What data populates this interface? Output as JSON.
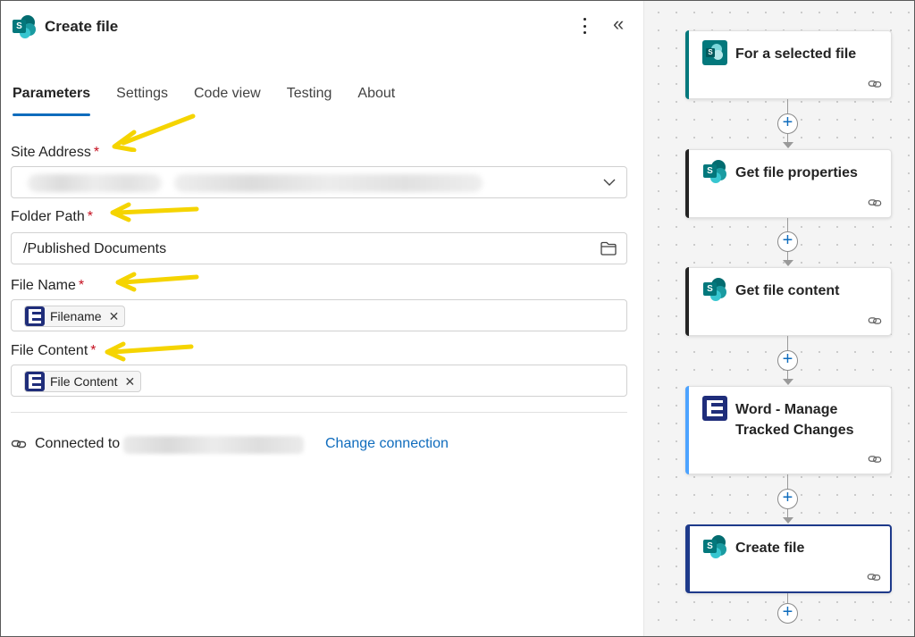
{
  "panel": {
    "title": "Create file",
    "more_icon": "more-vertical-icon",
    "collapse_icon": "chevron-double-left-icon"
  },
  "tabs": [
    {
      "label": "Parameters",
      "active": true
    },
    {
      "label": "Settings",
      "active": false
    },
    {
      "label": "Code view",
      "active": false
    },
    {
      "label": "Testing",
      "active": false
    },
    {
      "label": "About",
      "active": false
    }
  ],
  "fields": {
    "site_address": {
      "label": "Site Address",
      "required": "*",
      "value": ""
    },
    "folder_path": {
      "label": "Folder Path",
      "required": "*",
      "value": "/Published Documents"
    },
    "file_name": {
      "label": "File Name",
      "required": "*",
      "token": "Filename",
      "remove": "✕"
    },
    "file_content": {
      "label": "File Content",
      "required": "*",
      "token": "File Content",
      "remove": "✕"
    }
  },
  "connection": {
    "label": "Connected to",
    "change_link": "Change connection"
  },
  "flow": {
    "steps": [
      {
        "title": "For a selected file",
        "icon": "sharepoint-icon",
        "accent": "#03787c"
      },
      {
        "title": "Get file properties",
        "icon": "sharepoint-icon",
        "accent": "#242424"
      },
      {
        "title": "Get file content",
        "icon": "sharepoint-icon",
        "accent": "#242424"
      },
      {
        "title": "Word - Manage Tracked Changes",
        "icon": "encodian-icon",
        "accent": "#4da3ff"
      },
      {
        "title": "Create file",
        "icon": "sharepoint-icon",
        "accent": "#1e3a8a",
        "selected": true
      }
    ],
    "add_step_symbol": "+"
  },
  "colors": {
    "link_blue": "#0f6cbd",
    "required_red": "#c50f1f",
    "annotation_arrow": "#f5d400"
  }
}
